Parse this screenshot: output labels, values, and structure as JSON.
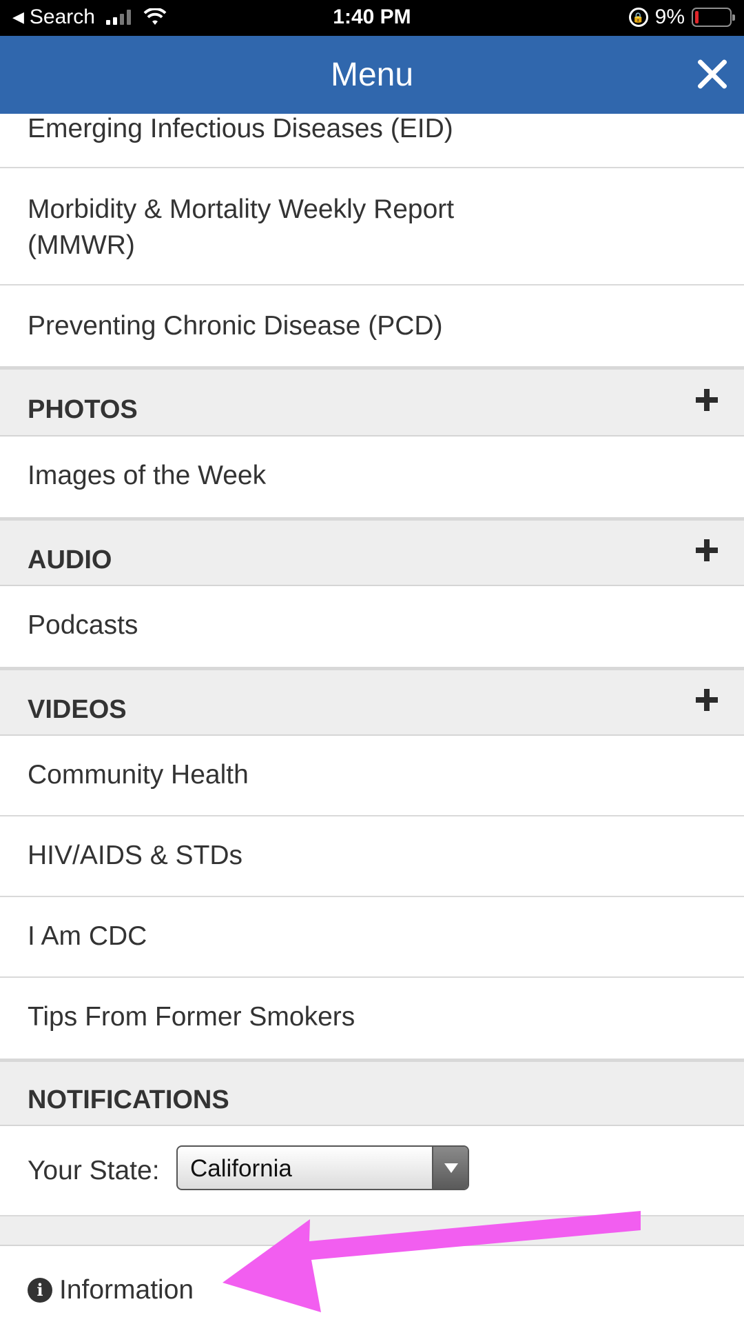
{
  "status_bar": {
    "back_label": "Search",
    "time": "1:40 PM",
    "battery": "9%",
    "battery_level": 0.09
  },
  "header": {
    "title": "Menu",
    "close_icon": "close-icon"
  },
  "menu": {
    "publications": [
      "Emerging Infectious Diseases (EID)",
      "Morbidity & Mortality Weekly Report (MMWR)",
      "Preventing Chronic Disease (PCD)"
    ],
    "photos": {
      "label": "PHOTOS",
      "items": [
        "Images of the Week"
      ]
    },
    "audio": {
      "label": "AUDIO",
      "items": [
        "Podcasts"
      ]
    },
    "videos": {
      "label": "VIDEOS",
      "items": [
        "Community Health",
        "HIV/AIDS & STDs",
        "I Am CDC",
        "Tips From Former Smokers"
      ]
    },
    "notifications": {
      "label": "NOTIFICATIONS",
      "state_label": "Your State:",
      "state_value": "California"
    },
    "information": {
      "label": "Information",
      "icon": "info-icon"
    }
  },
  "annotation": {
    "arrow_color": "#f25ef0"
  },
  "colors": {
    "header": "#3067ad",
    "section_bg": "#eeeeee"
  }
}
